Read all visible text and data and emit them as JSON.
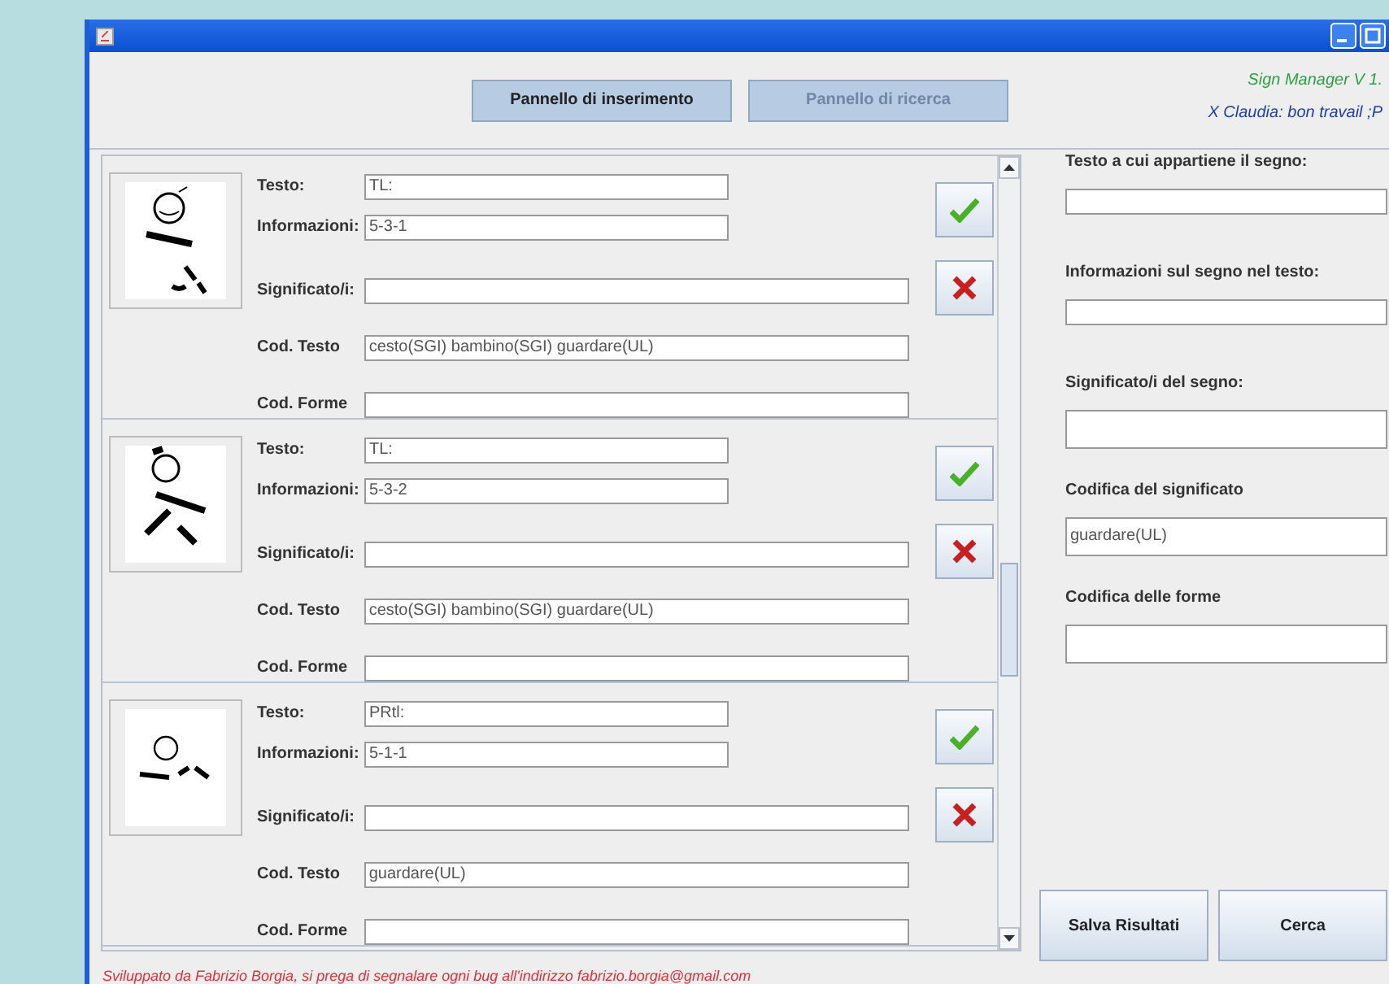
{
  "toolbar": {
    "buttons": [
      {
        "label": "Pannello di inserimento",
        "disabled": false
      },
      {
        "label": "Pannello di ricerca",
        "disabled": true
      }
    ],
    "app_version": "Sign Manager V 1.",
    "greeting": "X Claudia: bon travail ;P"
  },
  "entries": [
    {
      "fields": [
        {
          "label": "Testo:",
          "value": "TL:",
          "short": true
        },
        {
          "label": "Informazioni:",
          "value": "5-3-1",
          "short": true
        },
        {
          "label": "Significato/i:",
          "short": false
        },
        {
          "label": "Cod. Testo",
          "value": "cesto(SGI) bambino(SGI) guardare(UL)",
          "short": false
        },
        {
          "label": "Cod. Forme",
          "short": false
        }
      ]
    },
    {
      "fields": [
        {
          "label": "Testo:",
          "value": "TL:",
          "short": true
        },
        {
          "label": "Informazioni:",
          "value": "5-3-2",
          "short": true
        },
        {
          "label": "Significato/i:",
          "short": false
        },
        {
          "label": "Cod. Testo",
          "value": "cesto(SGI) bambino(SGI) guardare(UL)",
          "short": false
        },
        {
          "label": "Cod. Forme",
          "short": false
        }
      ]
    },
    {
      "fields": [
        {
          "label": "Testo:",
          "value": "PRtl:",
          "short": true
        },
        {
          "label": "Informazioni:",
          "value": "5-1-1",
          "short": true
        },
        {
          "label": "Significato/i:",
          "short": false
        },
        {
          "label": "Cod. Testo",
          "value": "guardare(UL)",
          "short": false
        },
        {
          "label": "Cod. Forme",
          "short": false
        }
      ]
    }
  ],
  "search_panel": {
    "fields": [
      {
        "label": "Testo a cui appartiene il segno:",
        "tall": false
      },
      {
        "label": "Informazioni sul segno nel testo:",
        "tall": false
      },
      {
        "label": "Significato/i del segno:",
        "tall": true
      },
      {
        "label": "Codifica del significato",
        "value": "guardare(UL)",
        "tall": true
      },
      {
        "label": "Codifica delle forme",
        "tall": true
      }
    ],
    "buttons": [
      "Salva Risultati",
      "Cerca"
    ]
  },
  "footer": "Sviluppato da Fabrizio Borgia, si prega di segnalare ogni bug all'indirizzo fabrizio.borgia@gmail.com"
}
